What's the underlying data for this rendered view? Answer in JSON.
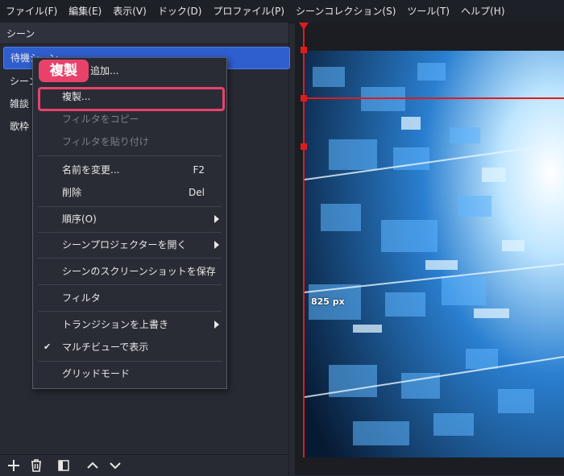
{
  "menubar": [
    "ファイル(F)",
    "編集(E)",
    "表示(V)",
    "ドック(D)",
    "プロファイル(P)",
    "シーンコレクション(S)",
    "ツール(T)",
    "ヘルプ(H)"
  ],
  "scenes": {
    "title": "シーン",
    "items": [
      "待機シーン",
      "シーン",
      "雑談",
      "歌枠"
    ]
  },
  "context_menu": {
    "add": "追加...",
    "duplicate": "複製...",
    "copy_filters": "フィルタをコピー",
    "paste_filters": "フィルタを貼り付け",
    "rename": "名前を変更...",
    "rename_shortcut": "F2",
    "delete": "削除",
    "delete_shortcut": "Del",
    "order": "順序(O)",
    "projector": "シーンプロジェクターを開く",
    "screenshot": "シーンのスクリーンショットを保存",
    "filters": "フィルタ",
    "transition_override": "トランジションを上書き",
    "multiview": "マルチビューで表示",
    "grid_mode": "グリッドモード"
  },
  "annotation": {
    "badge": "複製"
  },
  "preview": {
    "distance_label": "825 px"
  },
  "colors": {
    "selection": "#2f5ecf",
    "highlight": "#e8426b",
    "guide": "#e01b1b"
  }
}
